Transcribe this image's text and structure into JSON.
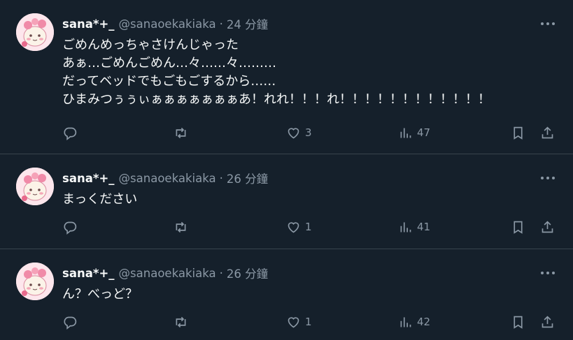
{
  "tweets": [
    {
      "name": "sana*+_",
      "handle": "@sanaoekakiaka",
      "separator": "·",
      "time": "24 分鐘",
      "text": "ごめんめっちゃさけんじゃった\nあぁ…ごめんごめん…々……々………\nだってベッドでもごもごするから……\nひまみつぅぅぃぁぁぁぁぁぁぁあ！れれ！！！れ！！！！！！！！！！！！",
      "likes": "3",
      "views": "47"
    },
    {
      "name": "sana*+_",
      "handle": "@sanaoekakiaka",
      "separator": "·",
      "time": "26 分鐘",
      "text": "まっください",
      "likes": "1",
      "views": "41"
    },
    {
      "name": "sana*+_",
      "handle": "@sanaoekakiaka",
      "separator": "·",
      "time": "26 分鐘",
      "text": "ん？べっど？",
      "likes": "1",
      "views": "42"
    }
  ],
  "icons": {
    "reply": "reply-icon",
    "retweet": "retweet-icon",
    "like": "heart-icon",
    "views": "views-icon",
    "bookmark": "bookmark-icon",
    "share": "share-icon",
    "more": "more-icon"
  },
  "colors": {
    "background": "#15202b",
    "divider": "#38444d",
    "text": "#f7f9f9",
    "muted": "#8b98a5"
  }
}
